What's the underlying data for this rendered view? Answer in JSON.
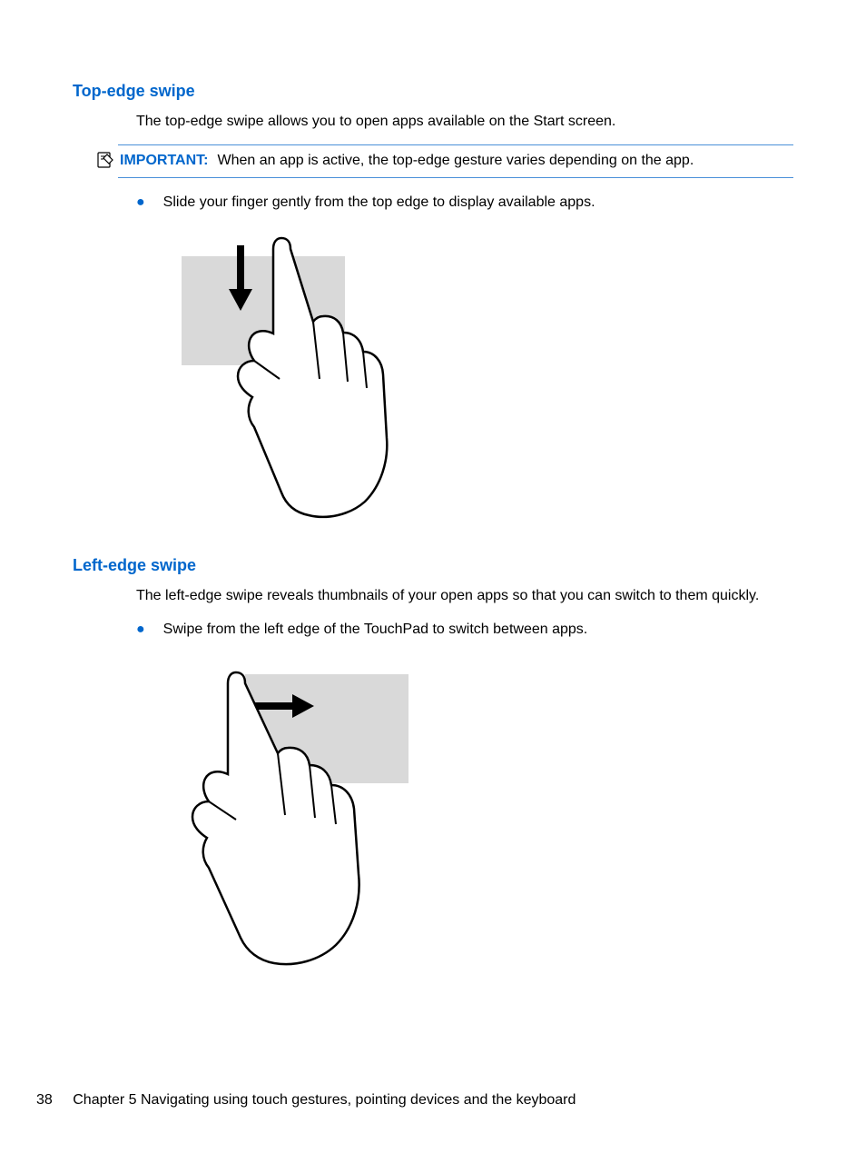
{
  "section1": {
    "heading": "Top-edge swipe",
    "intro": "The top-edge swipe allows you to open apps available on the Start screen.",
    "noteLabel": "IMPORTANT:",
    "noteText": "When an app is active, the top-edge gesture varies depending on the app.",
    "bullet": "Slide your finger gently from the top edge to display available apps."
  },
  "section2": {
    "heading": "Left-edge swipe",
    "intro": "The left-edge swipe reveals thumbnails of your open apps so that you can switch to them quickly.",
    "bullet": "Swipe from the left edge of the TouchPad to switch between apps."
  },
  "footer": {
    "page": "38",
    "chapter": "Chapter 5   Navigating using touch gestures, pointing devices and the keyboard"
  }
}
